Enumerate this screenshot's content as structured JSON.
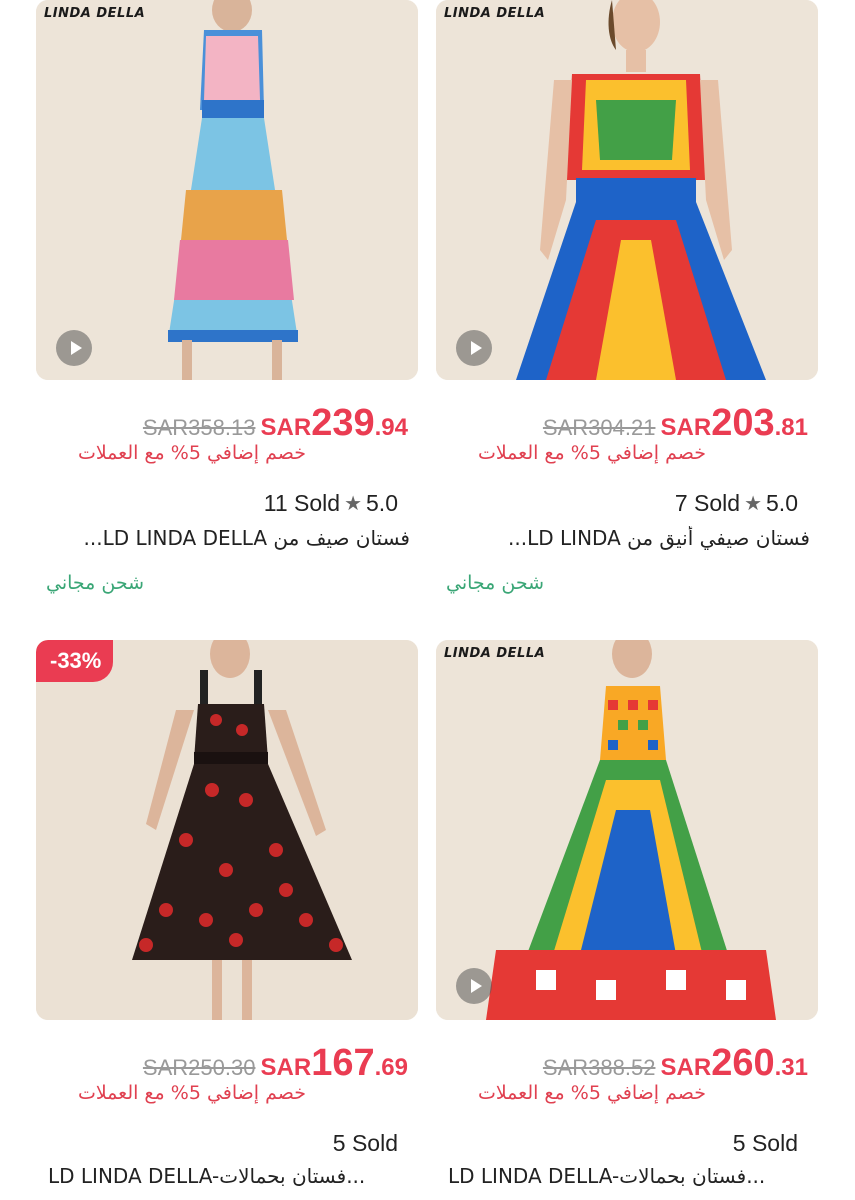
{
  "products": [
    {
      "brand": "LINDA DELLA",
      "old_price": "SAR358.13",
      "currency": "SAR",
      "price_int": "239",
      "price_dec": ".94",
      "discount_text": "خصم إضافي 5% مع العملات",
      "rating": "5.0",
      "sold": "11 Sold",
      "title": "فستان صيف من LD LINDA DELLA...",
      "shipping": "شحن مجاني",
      "has_video": true
    },
    {
      "brand": "LINDA DELLA",
      "old_price": "SAR304.21",
      "currency": "SAR",
      "price_int": "203",
      "price_dec": ".81",
      "discount_text": "خصم إضافي 5% مع العملات",
      "rating": "5.0",
      "sold": "7 Sold",
      "title": "فستان صيفي أنيق من LD LINDA...",
      "shipping": "شحن مجاني",
      "has_video": true
    },
    {
      "badge": "-33%",
      "old_price": "SAR250.30",
      "currency": "SAR",
      "price_int": "167",
      "price_dec": ".69",
      "discount_text": "خصم إضافي 5% مع العملات",
      "sold": "5 Sold",
      "title": "LD LINDA DELLA-فستان بحمالات...",
      "has_video": false
    },
    {
      "brand": "LINDA DELLA",
      "old_price": "SAR388.52",
      "currency": "SAR",
      "price_int": "260",
      "price_dec": ".31",
      "discount_text": "خصم إضافي 5% مع العملات",
      "sold": "5 Sold",
      "title": "LD LINDA DELLA-فستان بحمالات...",
      "has_video": true
    }
  ],
  "colors": {
    "accent": "#ea3c52",
    "shipping": "#3aa676",
    "muted": "#999999",
    "image_bg": "#ece3d7"
  }
}
